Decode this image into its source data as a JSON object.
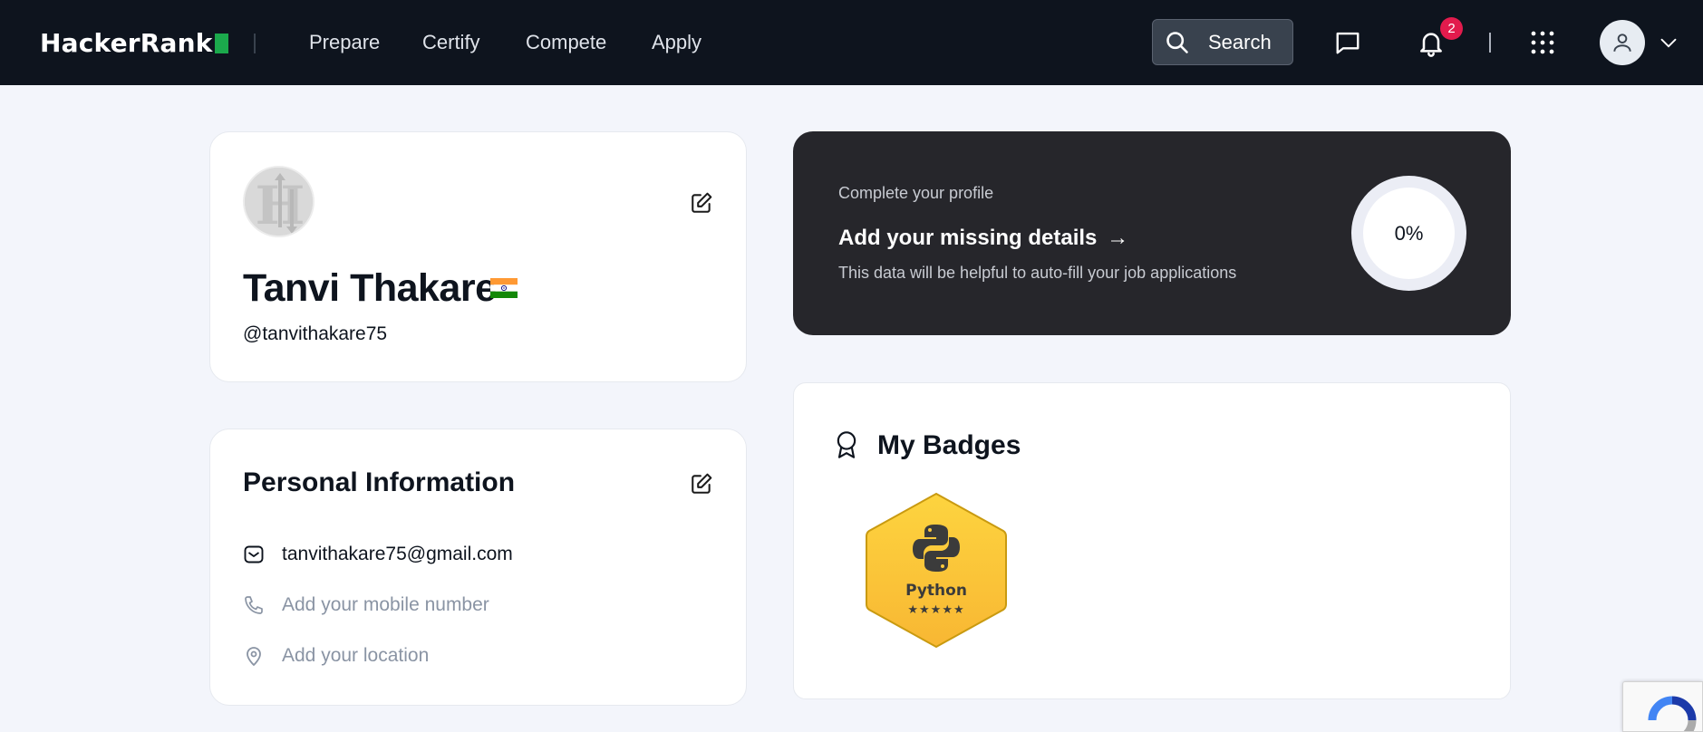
{
  "brand": {
    "name": "HackerRank",
    "accent": "#1ba94c"
  },
  "nav": {
    "links": [
      "Prepare",
      "Certify",
      "Compete",
      "Apply"
    ],
    "search_label": "Search",
    "notification_count": "2",
    "icons": [
      "search-icon",
      "chat-icon",
      "bell-icon",
      "grid-apps-icon",
      "user-icon",
      "chevron-down-icon"
    ]
  },
  "profile": {
    "name": "Tanvi Thakare",
    "username": "@tanvithakare75",
    "country_flag": "india-flag"
  },
  "complete_profile": {
    "subtitle": "Complete your profile",
    "title": "Add your missing details",
    "arrow": "→",
    "description": "This data will be helpful to auto-fill your job applications",
    "progress": "0%"
  },
  "personal_info": {
    "title": "Personal Information",
    "email": "tanvithakare75@gmail.com",
    "mobile_placeholder": "Add your mobile number",
    "location_placeholder": "Add your location"
  },
  "badges": {
    "title": "My Badges",
    "items": [
      {
        "name": "Python",
        "stars": "★★★★★",
        "color": "#fcc93d"
      }
    ]
  }
}
